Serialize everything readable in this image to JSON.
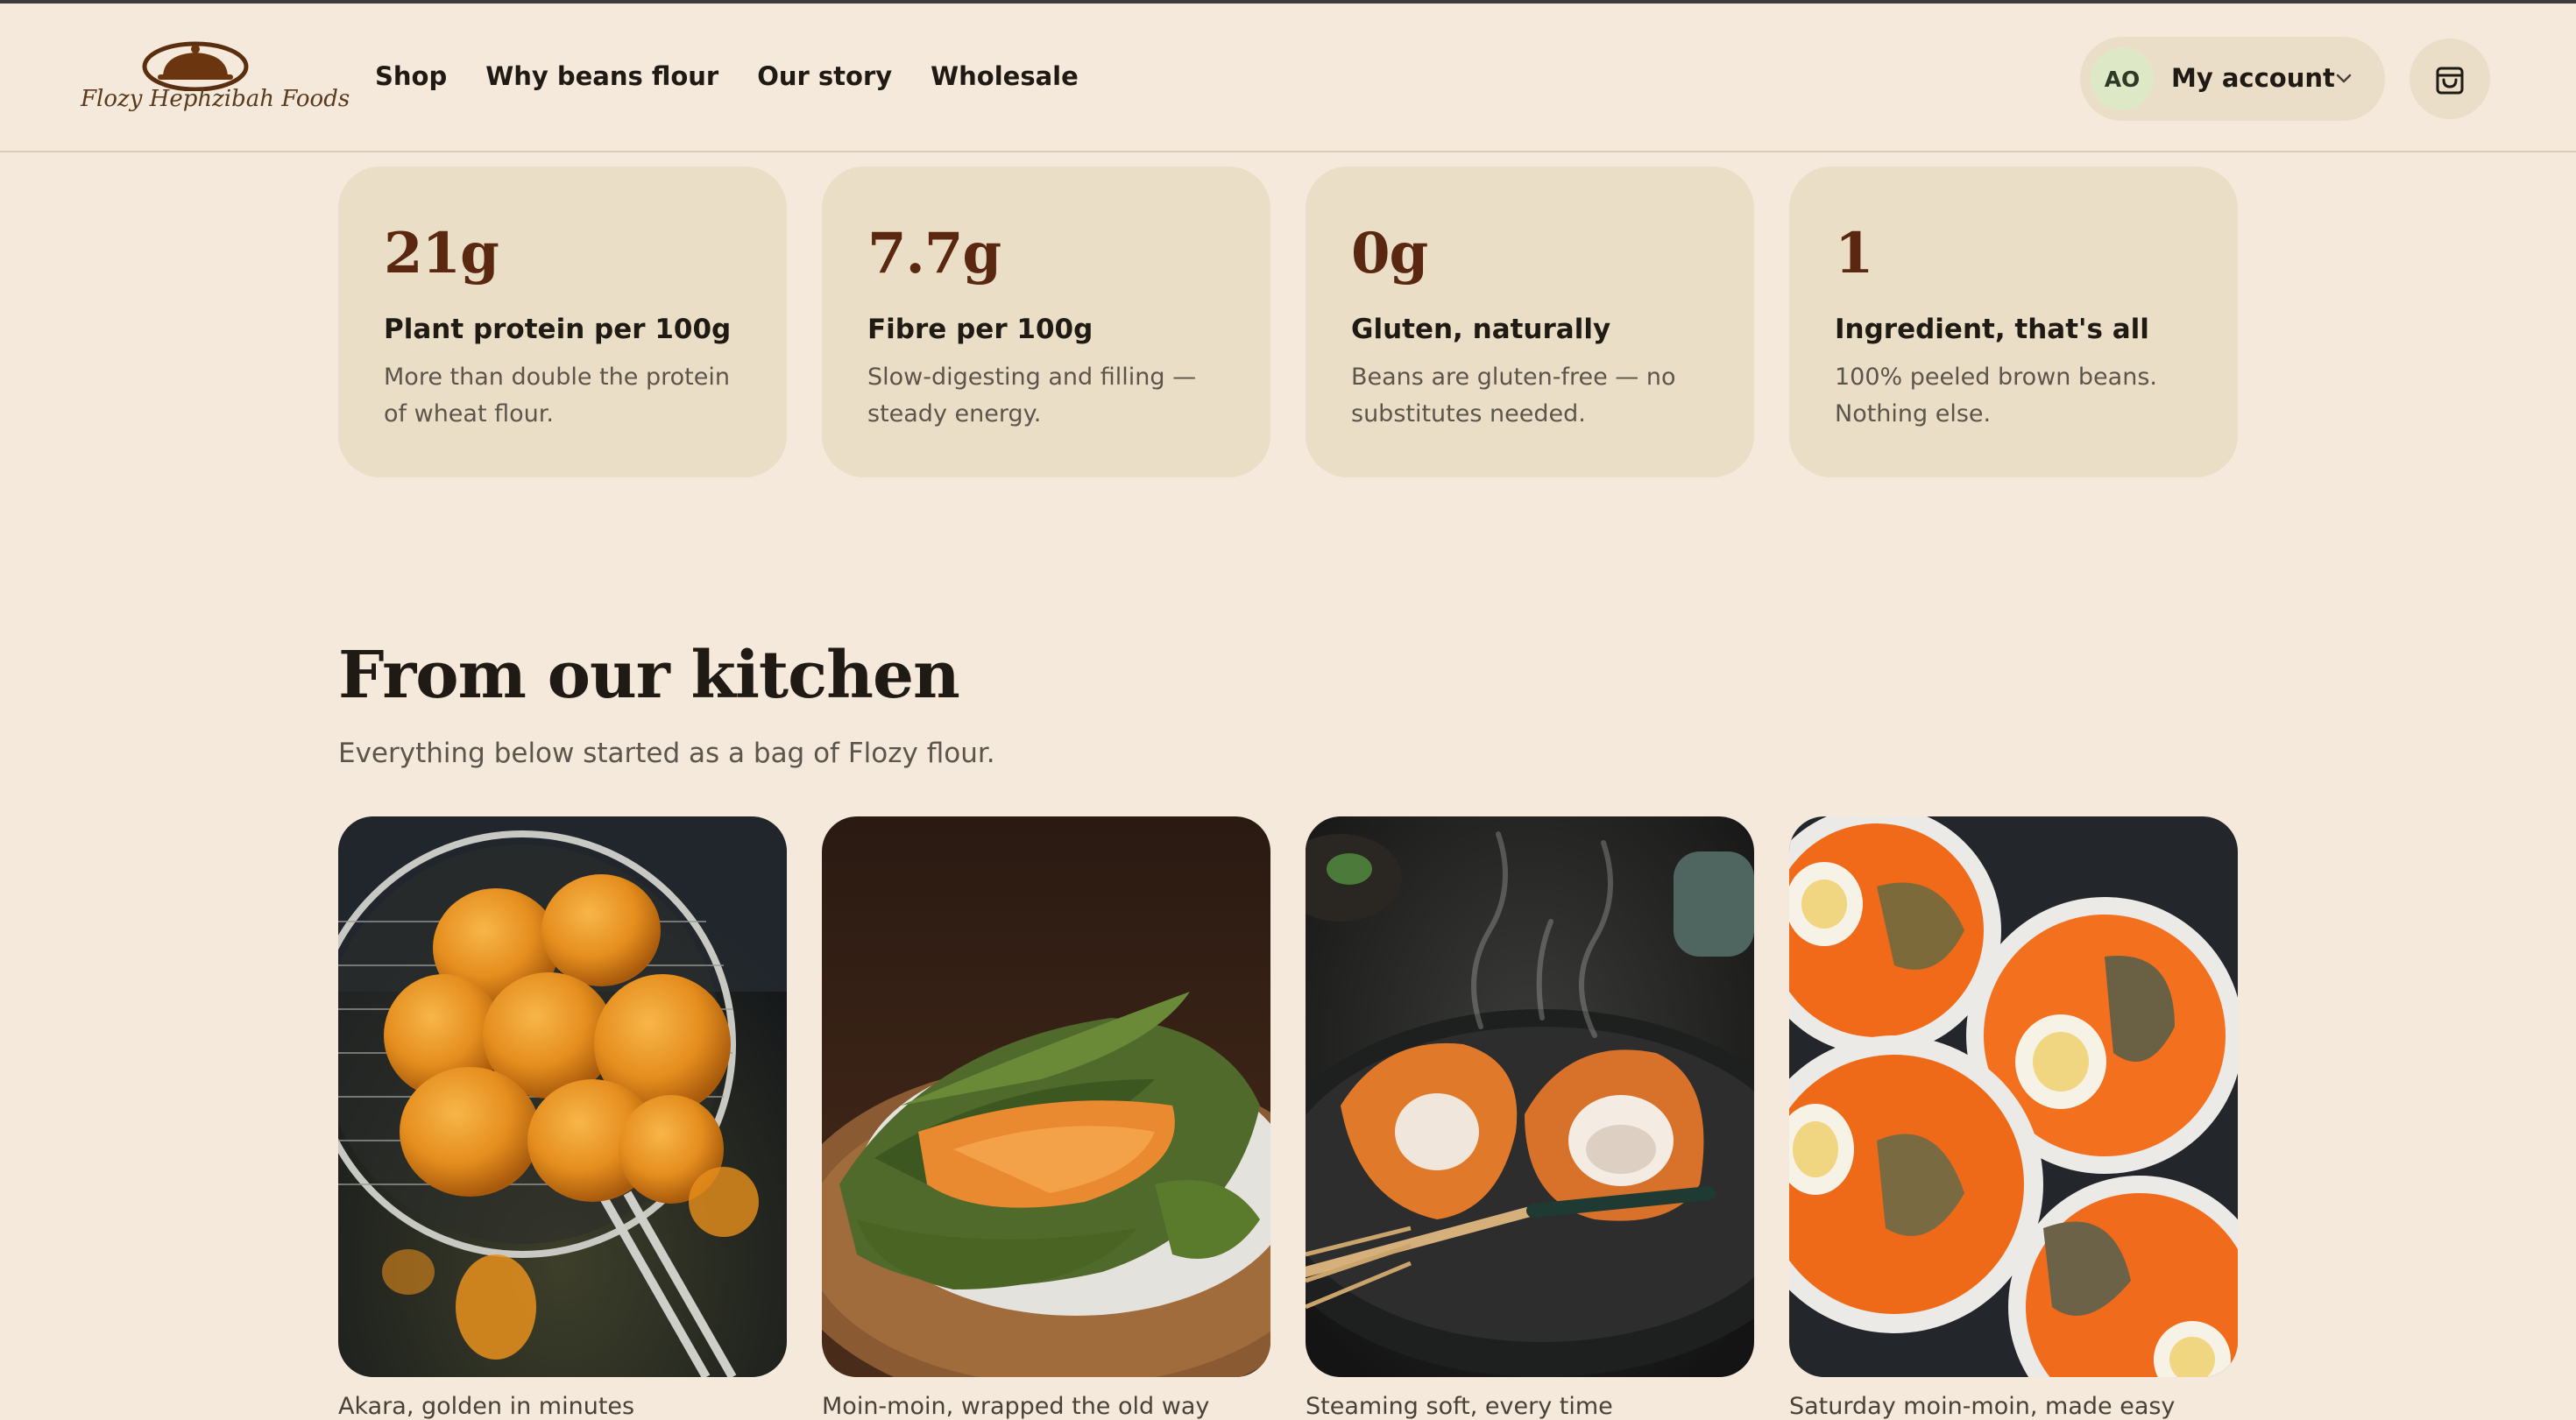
{
  "brand": {
    "name": "Flozy Hephzibah Foods",
    "logo_icon": "cloche-icon"
  },
  "nav": [
    "Shop",
    "Why beans flour",
    "Our story",
    "Wholesale"
  ],
  "account": {
    "initials": "AO",
    "label": "My account",
    "chevron_icon": "chevron-down-icon"
  },
  "cart": {
    "icon": "shopping-bag-icon"
  },
  "stats": [
    {
      "value": "21g",
      "title": "Plant protein per 100g",
      "desc": "More than double the protein of wheat flour."
    },
    {
      "value": "7.7g",
      "title": "Fibre per 100g",
      "desc": "Slow-digesting and filling — steady energy."
    },
    {
      "value": "0g",
      "title": "Gluten, naturally",
      "desc": "Beans are gluten-free — no substitutes needed."
    },
    {
      "value": "1",
      "title": "Ingredient, that's all",
      "desc": "100% peeled brown beans. Nothing else."
    }
  ],
  "kitchen": {
    "title": "From our kitchen",
    "subtitle": "Everything below started as a bag of Flozy flour.",
    "recipes": [
      {
        "caption": "Akara, golden in minutes",
        "image": "akara-photo"
      },
      {
        "caption": "Moin-moin, wrapped the old way",
        "image": "moin-moin-leaves-photo"
      },
      {
        "caption": "Steaming soft, every time",
        "image": "steamed-moin-moin-photo"
      },
      {
        "caption": "Saturday moin-moin, made easy",
        "image": "moin-moin-bowls-photo"
      }
    ]
  },
  "colors": {
    "background": "#f4e9da",
    "card": "#ebdec6",
    "accent": "#5a2810",
    "avatar": "#dde9c6"
  }
}
